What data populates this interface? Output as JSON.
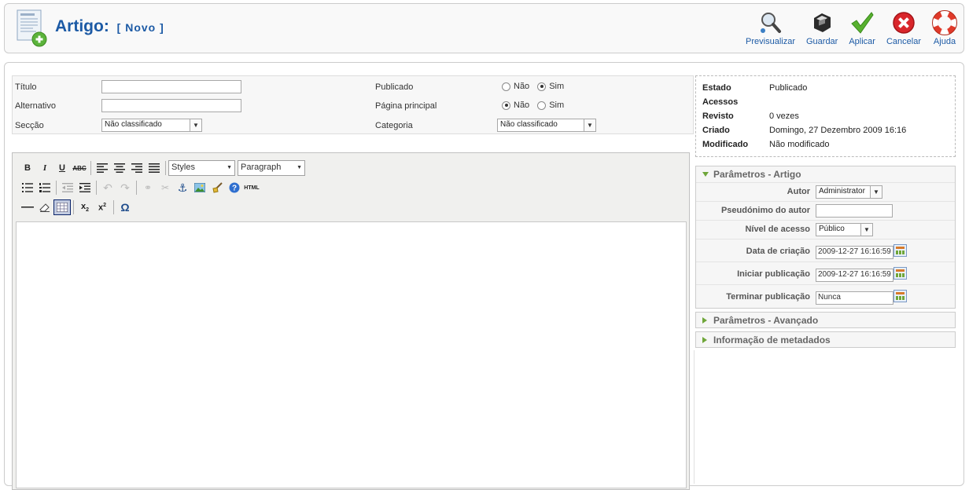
{
  "header": {
    "title": "Artigo:",
    "subtitle": "[ Novo ]",
    "toolbar": [
      {
        "label": "Previsualizar",
        "icon": "preview-icon"
      },
      {
        "label": "Guardar",
        "icon": "save-icon"
      },
      {
        "label": "Aplicar",
        "icon": "apply-icon"
      },
      {
        "label": "Cancelar",
        "icon": "cancel-icon"
      },
      {
        "label": "Ajuda",
        "icon": "help-icon"
      }
    ]
  },
  "details": {
    "title_label": "Título",
    "title_value": "",
    "alias_label": "Alternativo",
    "alias_value": "",
    "section_label": "Secção",
    "section_value": "Não classificado",
    "published_label": "Publicado",
    "frontpage_label": "Página principal",
    "category_label": "Categoria",
    "category_value": "Não classificado",
    "no_label": "Não",
    "yes_label": "Sim",
    "published_selected": "yes",
    "frontpage_selected": "no"
  },
  "editor": {
    "styles_label": "Styles",
    "format_label": "Paragraph",
    "buttons": {
      "bold": "B",
      "italic": "I",
      "underline": "U",
      "strike": "ABC",
      "html": "HTML",
      "omega": "Ω"
    }
  },
  "info": {
    "rows": [
      {
        "key": "Estado",
        "value": "Publicado"
      },
      {
        "key": "Acessos",
        "value": ""
      },
      {
        "key": "Revisto",
        "value": "0 vezes"
      },
      {
        "key": "Criado",
        "value": "Domingo, 27 Dezembro 2009 16:16"
      },
      {
        "key": "Modificado",
        "value": "Não modificado"
      }
    ]
  },
  "params": {
    "title": "Parâmetros - Artigo",
    "author_label": "Autor",
    "author_value": "Administrator",
    "alias_label": "Pseudónimo do autor",
    "alias_value": "",
    "access_label": "Nível de acesso",
    "access_value": "Público",
    "created_label": "Data de criação",
    "created_value": "2009-12-27 16:16:59",
    "publish_up_label": "Iniciar publicação",
    "publish_up_value": "2009-12-27 16:16:59",
    "publish_down_label": "Terminar publicação",
    "publish_down_value": "Nunca"
  },
  "advanced": {
    "title": "Parâmetros - Avançado"
  },
  "metadata": {
    "title": "Informação de metadados"
  },
  "colors": {
    "brand": "#1c5aa5",
    "accent_green": "#6fa63a",
    "cancel_red": "#d9262b"
  }
}
